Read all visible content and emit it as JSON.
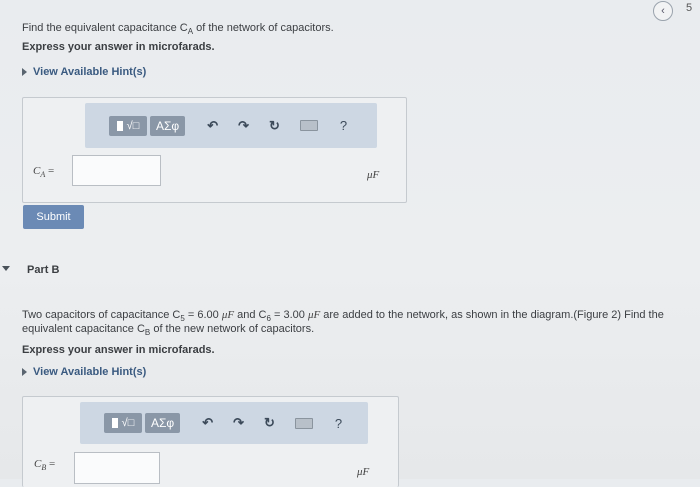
{
  "nav": {
    "back_symbol": "‹",
    "page_number": "5"
  },
  "partA": {
    "question": "Find the equivalent capacitance C",
    "question_sub": "A",
    "question_tail": " of the network of capacitors.",
    "instruction": "Express your answer in microfarads.",
    "hints_label": "View Available Hint(s)",
    "toolbar": {
      "greek": "ΑΣφ",
      "help": "?"
    },
    "eq_label": "C",
    "eq_sub": "A",
    "eq_equals": " =",
    "input_value": "",
    "unit": "μF",
    "submit_label": "Submit"
  },
  "partB": {
    "title": "Part B",
    "question_line1": "Two capacitors of capacitance C",
    "c5_sub": "5",
    "c5_value": " = 6.00 ",
    "c5_unit": "μF",
    "and": " and C",
    "c6_sub": "6",
    "c6_value": " = 3.00 ",
    "c6_unit": "μF",
    "line1_tail": " are added to the network, as shown in the diagram.(Figure 2) Find the",
    "question_line2_a": "equivalent capacitance C",
    "line2_sub": "B",
    "question_line2_b": " of the new network of capacitors.",
    "instruction": "Express your answer in microfarads.",
    "hints_label": "View Available Hint(s)",
    "toolbar": {
      "greek": "ΑΣφ",
      "help": "?"
    },
    "eq_label": "C",
    "eq_sub": "B",
    "eq_equals": " =",
    "input_value": "",
    "unit": "μF"
  }
}
